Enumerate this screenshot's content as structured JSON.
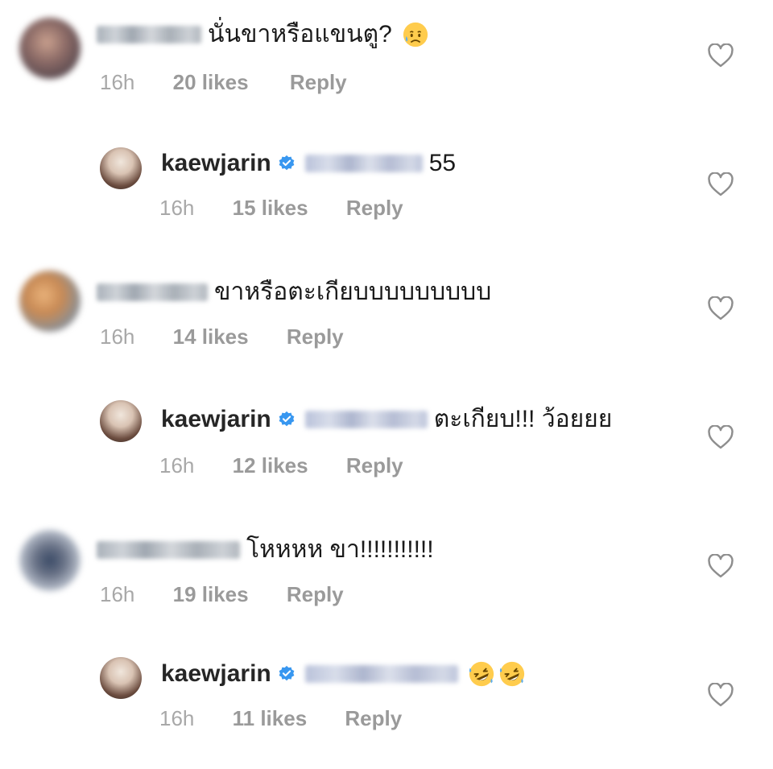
{
  "comments": [
    {
      "type": "top",
      "username": "",
      "text": "นั่นขาหรือแขนตู?",
      "emoji": [
        "sad-sweat-face"
      ],
      "time": "16h",
      "likes": "20 likes",
      "reply": "Reply"
    },
    {
      "type": "reply",
      "username": "kaewjarin",
      "text": "55",
      "emoji": [],
      "time": "16h",
      "likes": "15 likes",
      "reply": "Reply"
    },
    {
      "type": "top",
      "username": "",
      "text": "ขาหรือตะเกียบบบบบบบบบ",
      "emoji": [],
      "time": "16h",
      "likes": "14 likes",
      "reply": "Reply"
    },
    {
      "type": "reply",
      "username": "kaewjarin",
      "text": "ตะเกียบ!!! ว้อยยย",
      "emoji": [],
      "time": "16h",
      "likes": "12 likes",
      "reply": "Reply"
    },
    {
      "type": "top",
      "username": "",
      "text": "โหหหห ขา!!!!!!!!!!!",
      "emoji": [],
      "time": "16h",
      "likes": "19 likes",
      "reply": "Reply"
    },
    {
      "type": "reply",
      "username": "kaewjarin",
      "text": "",
      "emoji": [
        "rolling-laughing-face",
        "rolling-laughing-face"
      ],
      "time": "16h",
      "likes": "11 likes",
      "reply": "Reply"
    }
  ],
  "colors": {
    "verified": "#3897f0",
    "meta": "#9a9a9a",
    "text": "#262626"
  },
  "icons": {
    "like": "heart-outline-icon",
    "verified": "verified-badge-icon"
  }
}
